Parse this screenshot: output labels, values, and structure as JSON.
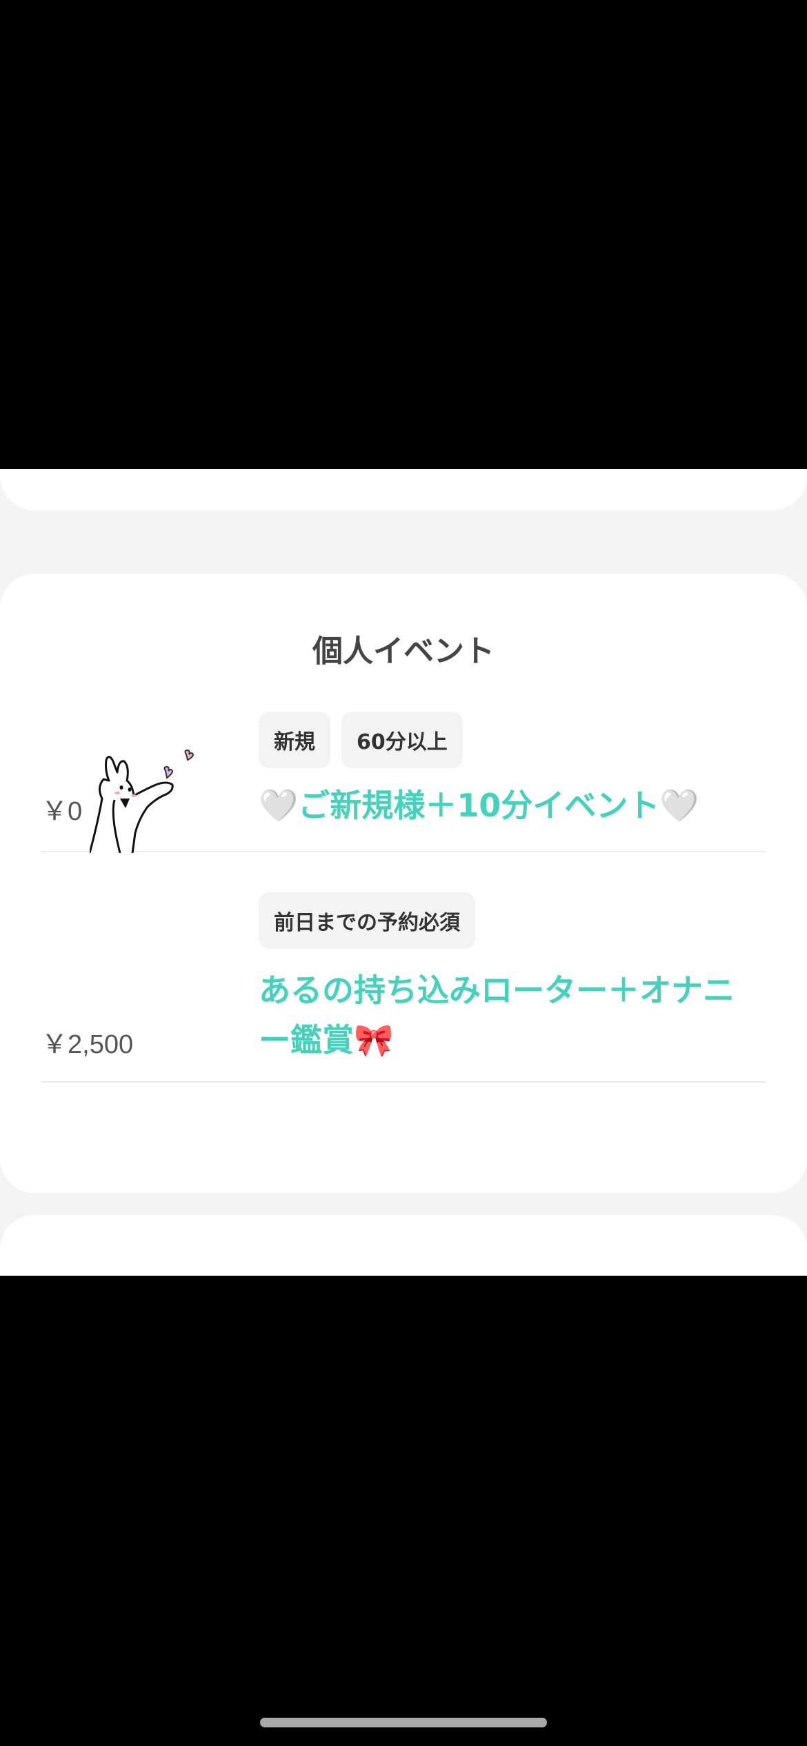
{
  "section": {
    "title": "個人イベント"
  },
  "events": [
    {
      "price": "￥0",
      "tags": [
        "新規",
        "60分以上"
      ],
      "title_prefix": "🤍",
      "title_text": "ご新規様＋10分イベント",
      "title_suffix": "🤍"
    },
    {
      "price": "￥2,500",
      "tags": [
        "前日までの予約必須"
      ],
      "title_text": "あるの持ち込みローター＋オナニー鑑賞",
      "title_suffix": "🎀"
    }
  ],
  "colors": {
    "accent": "#45d2bd",
    "heart_outline": "#e6e6e6",
    "bow": "#ff8fb1",
    "background": "#f4f4f4",
    "card": "#ffffff"
  },
  "icons": {
    "decoration": "bunny-with-hearts-illustration",
    "heart": "white-heart-emoji",
    "bow": "ribbon-bow-emoji"
  }
}
